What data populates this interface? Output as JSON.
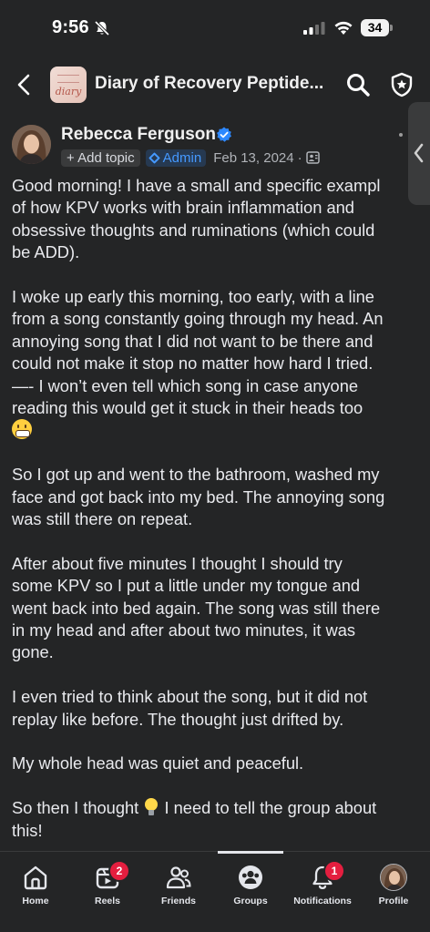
{
  "status_bar": {
    "time": "9:56",
    "battery": "34",
    "icons": [
      "bell-off-icon",
      "signal-icon",
      "wifi-icon",
      "battery-icon"
    ]
  },
  "header": {
    "group_name": "Diary of Recovery Peptide...",
    "thumb_text": "diary",
    "icons": [
      "back-icon",
      "search-icon",
      "admin-shield-icon"
    ]
  },
  "post": {
    "author": "Rebecca Ferguson",
    "add_topic": "+ Add topic",
    "admin_label": "Admin",
    "date": "Feb 13, 2024",
    "separator": "·",
    "paragraphs": [
      [
        "Good morning! I have a small and specific exampl",
        "of how KPV works with brain inflammation and",
        "obsessive thoughts and ruminations (which could",
        "be ADD)."
      ],
      [
        "I woke up early this morning, too early, with a line",
        "from a song constantly going through my head. An",
        "annoying song that I did not want to be there and",
        "could not make it stop no matter how hard I tried.",
        "—- I won’t even tell which song in case anyone",
        "reading this would get it stuck in their heads too"
      ],
      [
        "So I got up and went to the bathroom, washed my",
        "face and got back into my bed. The annoying song",
        "was still there on repeat."
      ],
      [
        "After about five minutes I thought I should try",
        "some KPV so I put a little under my tongue and",
        "went back into bed again. The song was still there",
        "in my head and after about two minutes, it was",
        "gone."
      ],
      [
        "I even tried to think about the song, but it did not",
        "replay like before. The thought just drifted by."
      ],
      [
        "My whole head was quiet and peaceful."
      ],
      [
        "So then I thought",
        "I need to tell the group about",
        "this!"
      ]
    ],
    "emojis": [
      "grimacing-face-icon",
      "light-bulb-icon"
    ]
  },
  "bottom_nav": {
    "items": [
      {
        "label": "Home",
        "icon": "home-icon"
      },
      {
        "label": "Reels",
        "icon": "reels-icon",
        "badge": "2"
      },
      {
        "label": "Friends",
        "icon": "friends-icon"
      },
      {
        "label": "Groups",
        "icon": "groups-icon",
        "active": true
      },
      {
        "label": "Notifications",
        "icon": "bell-icon",
        "badge": "1"
      },
      {
        "label": "Profile",
        "icon": "profile-avatar"
      }
    ]
  },
  "colors": {
    "background": "#242526",
    "text": "#e4e6eb",
    "accent": "#4599ff",
    "badge": "#e41e3f"
  }
}
